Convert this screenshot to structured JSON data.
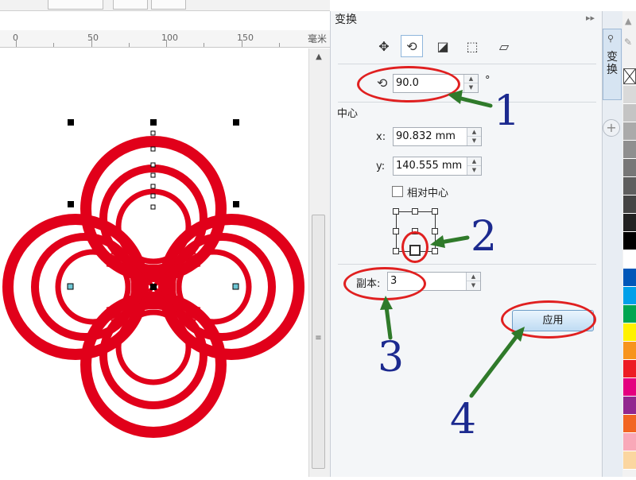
{
  "ruler": {
    "ticks": [
      "0",
      "50",
      "100",
      "150"
    ],
    "unit": "毫米"
  },
  "panel": {
    "title": "变换",
    "controls_icon": "double-chevron-right-icon",
    "close_icon": "close-icon",
    "tabs": [
      {
        "name": "position",
        "glyph": "✥"
      },
      {
        "name": "rotate",
        "glyph": "⟲"
      },
      {
        "name": "scale",
        "glyph": "◪"
      },
      {
        "name": "size",
        "glyph": "⬚"
      },
      {
        "name": "skew",
        "glyph": "▱"
      }
    ],
    "angle": {
      "icon_glyph": "⟲",
      "value": "90.0",
      "unit": "°"
    },
    "center": {
      "label": "中心",
      "x_label": "x:",
      "x_value": "90.832 mm",
      "y_label": "y:",
      "y_value": "140.555 mm",
      "relative_label": "相对中心"
    },
    "copies": {
      "label": "副本:",
      "value": "3"
    },
    "apply_label": "应用"
  },
  "annotations": [
    "1",
    "2",
    "3",
    "4"
  ],
  "dock_tab": {
    "label": "变换",
    "add_glyph": "+"
  },
  "colors": {
    "shape": "#e1001a",
    "annotation_oval": "#e02020",
    "annotation_arrow": "#2f7a2a",
    "annotation_number": "#1c2a8f",
    "palette": [
      "#d9d9d9",
      "#c4c4c4",
      "#aaaaaa",
      "#8f8f8f",
      "#777777",
      "#5e5e5e",
      "#444444",
      "#222222",
      "#000000",
      "#ffffff",
      "#0057b8",
      "#00a0e9",
      "#00a651",
      "#fff200",
      "#f7941d",
      "#ed1c24",
      "#e4007f",
      "#92278f",
      "#f26522",
      "#f9a8b8",
      "#fbd6a0"
    ]
  }
}
